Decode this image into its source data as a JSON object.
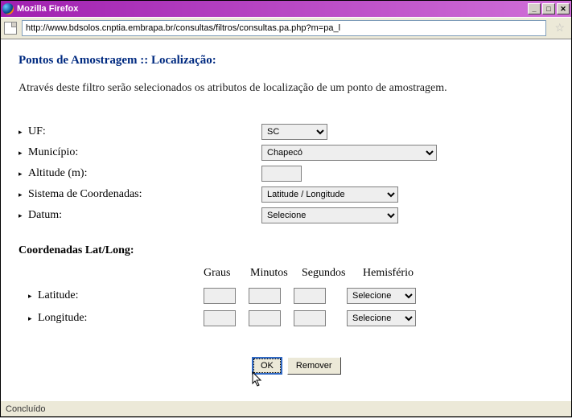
{
  "window": {
    "title": "Mozilla Firefox"
  },
  "address": {
    "url": "http://www.bdsolos.cnptia.embrapa.br/consultas/filtros/consultas.pa.php?m=pa_l"
  },
  "page": {
    "title": "Pontos de Amostragem :: Localização:",
    "intro": "Através deste filtro serão selecionados os atributos de localização de um ponto de amostragem."
  },
  "form": {
    "uf": {
      "label": "UF:",
      "value": "SC"
    },
    "municipio": {
      "label": "Município:",
      "value": "Chapecó"
    },
    "altitude": {
      "label": "Altitude (m):",
      "value": ""
    },
    "sistema": {
      "label": "Sistema de Coordenadas:",
      "value": "Latitude / Longitude"
    },
    "datum": {
      "label": "Datum:",
      "value": "Selecione"
    }
  },
  "coords": {
    "section_title": "Coordenadas Lat/Long:",
    "headers": {
      "graus": "Graus",
      "minutos": "Minutos",
      "segundos": "Segundos",
      "hemisferio": "Hemisfério"
    },
    "latitude": {
      "label": "Latitude:",
      "hemisferio": "Selecione"
    },
    "longitude": {
      "label": "Longitude:",
      "hemisferio": "Selecione"
    }
  },
  "buttons": {
    "ok": "OK",
    "remover": "Remover"
  },
  "status": {
    "text": "Concluído"
  },
  "winbtn": {
    "min": "_",
    "max": "□",
    "close": "✕"
  }
}
